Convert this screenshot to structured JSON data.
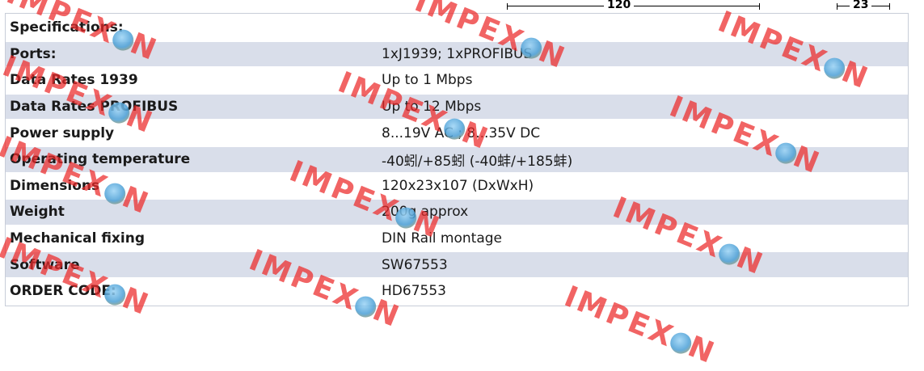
{
  "dimensions": {
    "top_left_label": "120",
    "top_right_label": "23"
  },
  "specs": [
    {
      "label": "Specifications:",
      "value": ""
    },
    {
      "label": "Ports:",
      "value": "1xJ1939; 1xPROFIBUS"
    },
    {
      "label": "Data Rates 1939",
      "value": "Up to 1 Mbps"
    },
    {
      "label": "Data Rates PROFIBUS",
      "value": "Up to 12 Mbps"
    },
    {
      "label": "Power supply",
      "value": "8...19V AC ; 8...35V DC"
    },
    {
      "label": "Operating temperature",
      "value": "-40蚓/+85蚓 (-40蚌/+185蚌)"
    },
    {
      "label": "Dimensions",
      "value": "120x23x107 (DxWxH)"
    },
    {
      "label": "Weight",
      "value": "200g approx"
    },
    {
      "label": "Mechanical fixing",
      "value": "DIN Rail montage"
    },
    {
      "label": "Software",
      "value": "SW67553"
    },
    {
      "label": "ORDER CODE:",
      "value": "HD67553"
    }
  ],
  "watermark": {
    "text_left": "IMPEX",
    "text_right": "N",
    "color": "#eb2828"
  }
}
